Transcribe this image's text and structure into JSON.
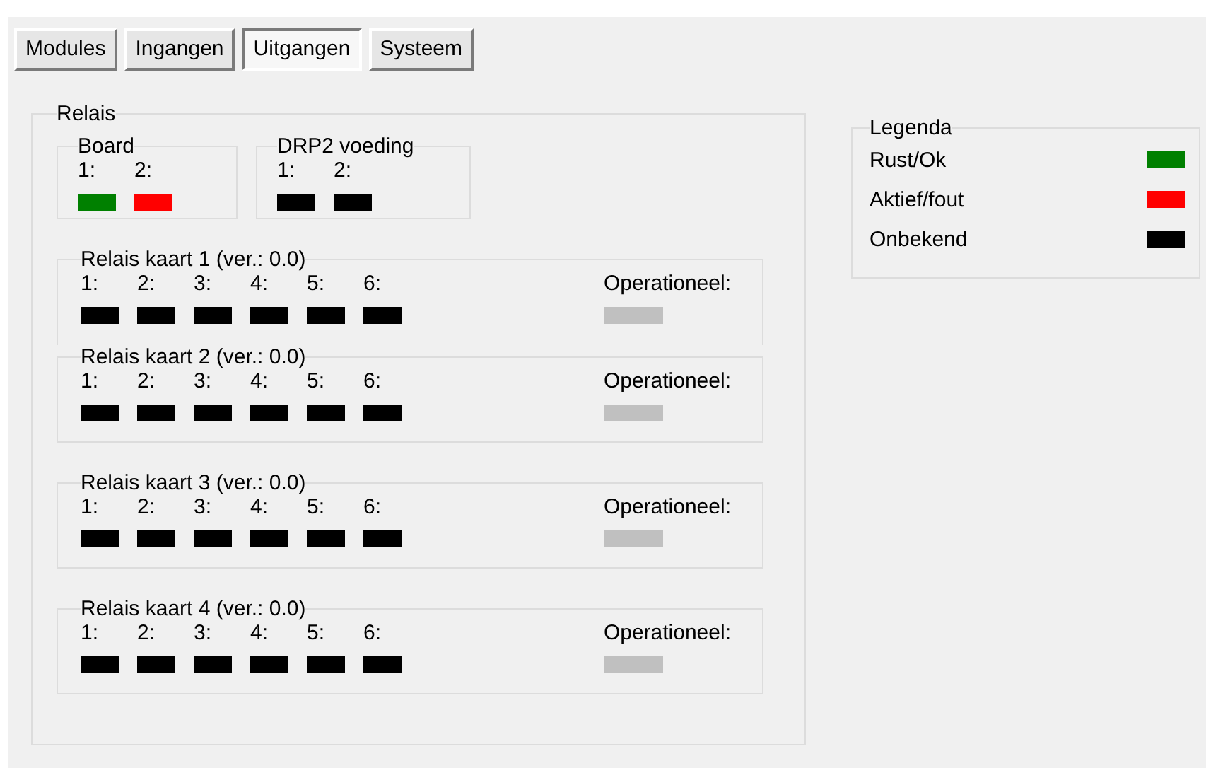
{
  "tabs": [
    {
      "label": "Modules",
      "selected": false
    },
    {
      "label": "Ingangen",
      "selected": false
    },
    {
      "label": "Uitgangen",
      "selected": true
    },
    {
      "label": "Systeem",
      "selected": false
    }
  ],
  "relais": {
    "title": "Relais",
    "small_groups": [
      {
        "title": "Board",
        "outputs": [
          {
            "label": "1:",
            "color": "#008000"
          },
          {
            "label": "2:",
            "color": "#ff0000"
          }
        ]
      },
      {
        "title": "DRP2 voeding",
        "outputs": [
          {
            "label": "1:",
            "color": "#000000"
          },
          {
            "label": "2:",
            "color": "#000000"
          }
        ]
      }
    ],
    "cards": [
      {
        "title": "Relais kaart 1 (ver.: 0.0)",
        "outputs": [
          {
            "label": "1:",
            "color": "#000000"
          },
          {
            "label": "2:",
            "color": "#000000"
          },
          {
            "label": "3:",
            "color": "#000000"
          },
          {
            "label": "4:",
            "color": "#000000"
          },
          {
            "label": "5:",
            "color": "#000000"
          },
          {
            "label": "6:",
            "color": "#000000"
          }
        ],
        "operational": {
          "label": "Operationeel:",
          "color": "#c0c0c0"
        }
      },
      {
        "title": "Relais kaart 2 (ver.: 0.0)",
        "outputs": [
          {
            "label": "1:",
            "color": "#000000"
          },
          {
            "label": "2:",
            "color": "#000000"
          },
          {
            "label": "3:",
            "color": "#000000"
          },
          {
            "label": "4:",
            "color": "#000000"
          },
          {
            "label": "5:",
            "color": "#000000"
          },
          {
            "label": "6:",
            "color": "#000000"
          }
        ],
        "operational": {
          "label": "Operationeel:",
          "color": "#c0c0c0"
        }
      },
      {
        "title": "Relais kaart 3 (ver.: 0.0)",
        "outputs": [
          {
            "label": "1:",
            "color": "#000000"
          },
          {
            "label": "2:",
            "color": "#000000"
          },
          {
            "label": "3:",
            "color": "#000000"
          },
          {
            "label": "4:",
            "color": "#000000"
          },
          {
            "label": "5:",
            "color": "#000000"
          },
          {
            "label": "6:",
            "color": "#000000"
          }
        ],
        "operational": {
          "label": "Operationeel:",
          "color": "#c0c0c0"
        }
      },
      {
        "title": "Relais kaart 4 (ver.: 0.0)",
        "outputs": [
          {
            "label": "1:",
            "color": "#000000"
          },
          {
            "label": "2:",
            "color": "#000000"
          },
          {
            "label": "3:",
            "color": "#000000"
          },
          {
            "label": "4:",
            "color": "#000000"
          },
          {
            "label": "5:",
            "color": "#000000"
          },
          {
            "label": "6:",
            "color": "#000000"
          }
        ],
        "operational": {
          "label": "Operationeel:",
          "color": "#c0c0c0"
        }
      }
    ]
  },
  "legend": {
    "title": "Legenda",
    "items": [
      {
        "label": "Rust/Ok",
        "color": "#008000"
      },
      {
        "label": "Aktief/fout",
        "color": "#ff0000"
      },
      {
        "label": "Onbekend",
        "color": "#000000"
      }
    ]
  }
}
